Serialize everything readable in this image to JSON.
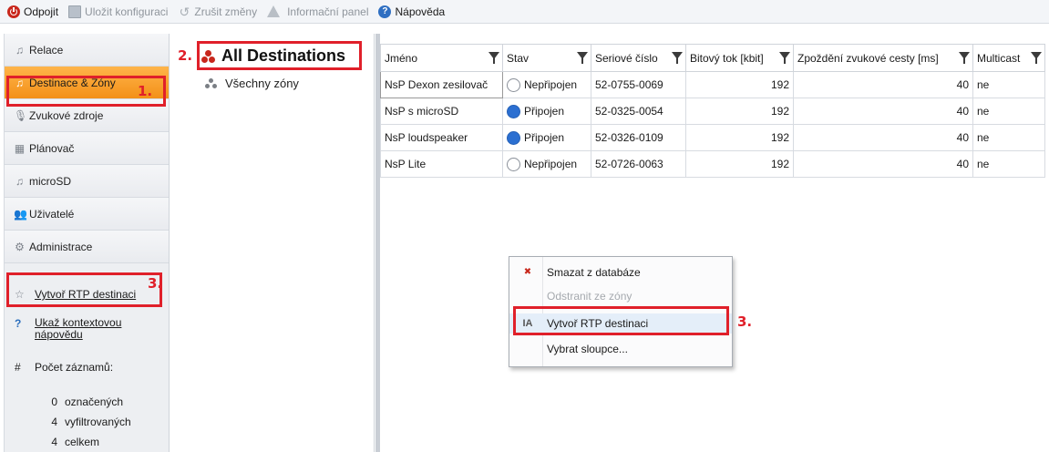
{
  "toolbar": {
    "disconnect": "Odpojit",
    "save_config": "Uložit konfiguraci",
    "discard_changes": "Zrušit změny",
    "info_panel": "Informační panel",
    "help": "Nápověda"
  },
  "sidebar": {
    "items": [
      {
        "label": "Relace",
        "icon": "music-note-icon"
      },
      {
        "label": "Destinace & Zóny",
        "icon": "music-note-icon"
      },
      {
        "label": "Zvukové zdroje",
        "icon": "microphone-icon"
      },
      {
        "label": "Plánovač",
        "icon": "calendar-icon"
      },
      {
        "label": "microSD",
        "icon": "music-note-icon"
      },
      {
        "label": "Uživatelé",
        "icon": "users-icon"
      },
      {
        "label": "Administrace",
        "icon": "gears-icon"
      }
    ],
    "create_rtp": "Vytvoř RTP destinaci",
    "context_help": "Ukaž kontextovou nápovědu",
    "records_title": "Počet záznamů:",
    "stats": [
      {
        "num": "0",
        "label": "označených"
      },
      {
        "num": "4",
        "label": "vyfiltrovaných"
      },
      {
        "num": "4",
        "label": "celkem"
      }
    ]
  },
  "tree": {
    "root": "All Destinations",
    "child": "Všechny zóny"
  },
  "grid": {
    "columns": [
      "Jméno",
      "Stav",
      "Seriové číslo",
      "Bitový tok [kbit]",
      "Zpoždění zvukové cesty [ms]",
      "Multicast"
    ],
    "rows": [
      {
        "name": "NsP Dexon zesilovač",
        "status": "Nepřipojen",
        "connected": false,
        "serial": "52-0755-0069",
        "bitrate": "192",
        "delay": "40",
        "multicast": "ne"
      },
      {
        "name": "NsP s microSD",
        "status": "Připojen",
        "connected": true,
        "serial": "52-0325-0054",
        "bitrate": "192",
        "delay": "40",
        "multicast": "ne"
      },
      {
        "name": "NsP loudspeaker",
        "status": "Připojen",
        "connected": true,
        "serial": "52-0326-0109",
        "bitrate": "192",
        "delay": "40",
        "multicast": "ne"
      },
      {
        "name": "NsP Lite",
        "status": "Nepřipojen",
        "connected": false,
        "serial": "52-0726-0063",
        "bitrate": "192",
        "delay": "40",
        "multicast": "ne"
      }
    ]
  },
  "context_menu": {
    "items": [
      {
        "label": "Smazat z databáze",
        "enabled": true,
        "icon": "delete-db-icon"
      },
      {
        "label": "Odstranit ze zóny",
        "enabled": false,
        "icon": ""
      },
      {
        "label": "Vytvoř RTP destinaci",
        "enabled": true,
        "icon": "rtp-destination-icon"
      },
      {
        "label": "Vybrat sloupce...",
        "enabled": true,
        "icon": ""
      }
    ]
  },
  "annotations": {
    "step1": "1.",
    "step2": "2.",
    "step3a": "3.",
    "step3b": "3."
  },
  "colors": {
    "accent_orange": "#f39018",
    "highlight_red": "#e0202a",
    "connected_blue": "#2b6fd1"
  }
}
